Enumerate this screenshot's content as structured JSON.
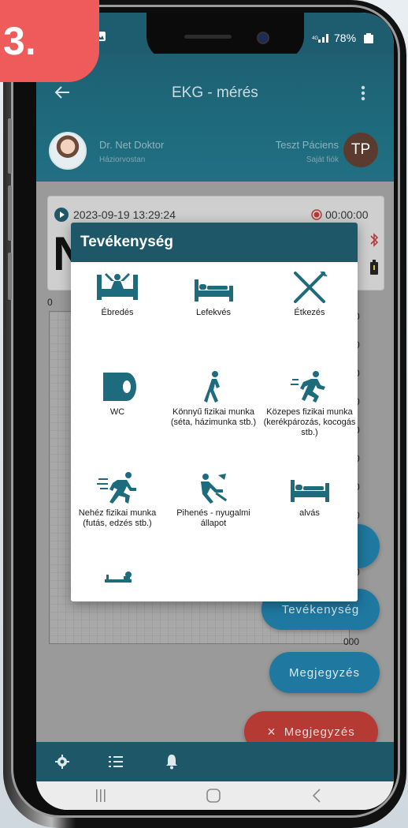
{
  "step_badge": "3.",
  "status_bar": {
    "battery": "78%"
  },
  "app_bar": {
    "title": "EKG - mérés"
  },
  "doctor": {
    "name": "Dr. Net Doktor",
    "role": "Háziorvostan"
  },
  "patient": {
    "name": "Teszt Páciens",
    "account": "Saját fiók",
    "initials": "TP"
  },
  "recording": {
    "datetime": "2023-09-19 13:29:24",
    "duration": "00:00:00",
    "big_letter": "N"
  },
  "chart": {
    "axis_start": "0",
    "axis_right_ticks": [
      "0",
      "0",
      "0",
      "0",
      "0",
      "0",
      "0",
      "0",
      "0",
      "0"
    ],
    "bottom_value": "000"
  },
  "modal": {
    "title": "Tevékenység",
    "activities": [
      {
        "label": "Ébredés",
        "icon": "wake-up-icon"
      },
      {
        "label": "Lefekvés",
        "icon": "bed-icon"
      },
      {
        "label": "Étkezés",
        "icon": "fork-knife-icon"
      },
      {
        "label": "WC",
        "icon": "toilet-paper-icon"
      },
      {
        "label": "Könnyű fizikai munka (séta, házimunka stb.)",
        "icon": "walking-icon"
      },
      {
        "label": "Közepes fizikai munka (kerékpározás, kocogás stb.)",
        "icon": "jogging-icon"
      },
      {
        "label": "Nehéz fizikai munka (futás, edzés stb.)",
        "icon": "running-icon"
      },
      {
        "label": "Pihenés - nyugalmi állapot",
        "icon": "reclining-icon"
      },
      {
        "label": "alvás",
        "icon": "sleep-bed-icon"
      },
      {
        "label": "",
        "icon": "lying-exercise-icon"
      }
    ]
  },
  "buttons": {
    "activity": "Tevékenység",
    "note": "Megjegyzés",
    "note_close": "Megjegyzés",
    "note_close_icon": "×"
  },
  "colors": {
    "primary": "#1e5868",
    "accent_blue": "#1f78a0",
    "accent_red": "#b63a34",
    "badge": "#ef5b5b",
    "icon_teal": "#1e6b7d"
  }
}
